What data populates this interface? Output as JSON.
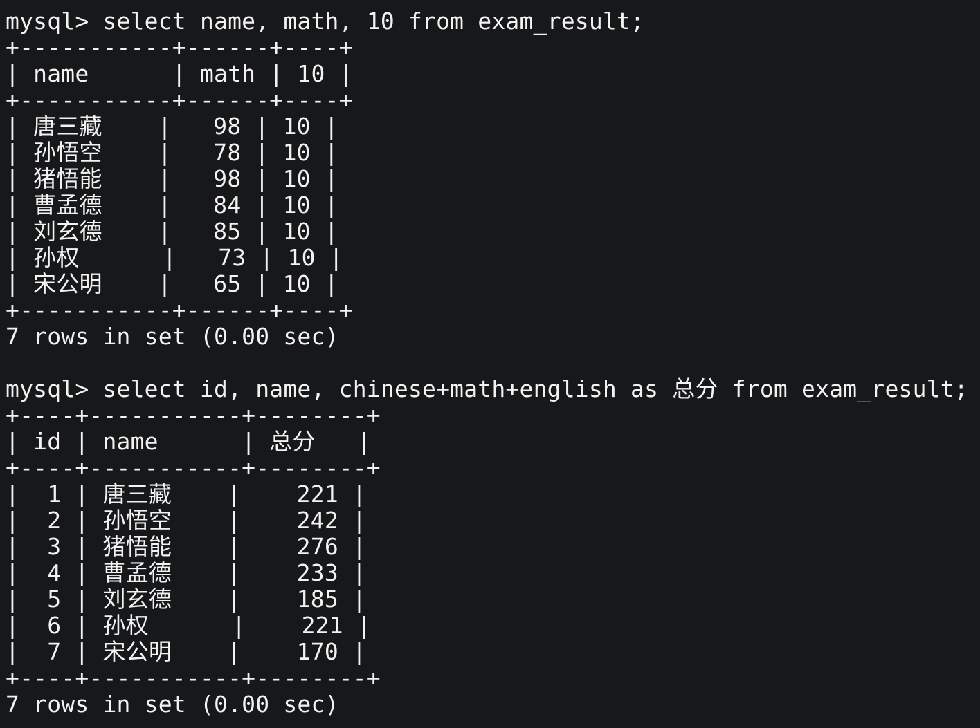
{
  "terminal": {
    "lines": [
      "mysql> select name, math, 10 from exam_result;",
      "+-----------+------+----+",
      "| name      | math | 10 |",
      "+-----------+------+----+",
      "| 唐三藏    |   98 | 10 |",
      "| 孙悟空    |   78 | 10 |",
      "| 猪悟能    |   98 | 10 |",
      "| 曹孟德    |   84 | 10 |",
      "| 刘玄德    |   85 | 10 |",
      "| 孙权      |   73 | 10 |",
      "| 宋公明    |   65 | 10 |",
      "+-----------+------+----+",
      "7 rows in set (0.00 sec)",
      "",
      "mysql> select id, name, chinese+math+english as 总分 from exam_result;",
      "+----+-----------+--------+",
      "| id | name      | 总分   |",
      "+----+-----------+--------+",
      "|  1 | 唐三藏    |    221 |",
      "|  2 | 孙悟空    |    242 |",
      "|  3 | 猪悟能    |    276 |",
      "|  4 | 曹孟德    |    233 |",
      "|  5 | 刘玄德    |    185 |",
      "|  6 | 孙权      |    221 |",
      "|  7 | 宋公明    |    170 |",
      "+----+-----------+--------+",
      "7 rows in set (0.00 sec)"
    ]
  }
}
